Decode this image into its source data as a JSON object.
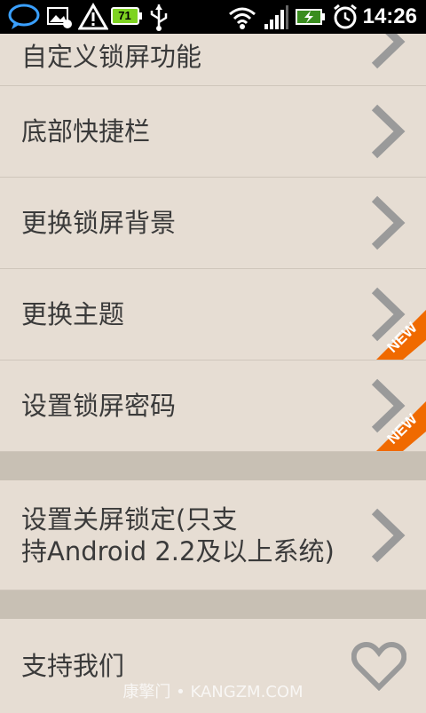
{
  "status_bar": {
    "battery_level": "71",
    "time": "14:26"
  },
  "settings_list": {
    "partial_top_label": "自定义锁屏功能",
    "items": [
      {
        "label": "底部快捷栏"
      },
      {
        "label": "更换锁屏背景"
      },
      {
        "label": "更换主题",
        "badge": "NEW"
      },
      {
        "label": "设置锁屏密码",
        "badge": "NEW"
      }
    ],
    "section2_item": {
      "label": "设置关屏锁定(只支\n持Android 2.2及以上系统)"
    },
    "section3_item": {
      "label": "支持我们"
    }
  },
  "watermark": "康擎门 • KANGZM.COM",
  "colors": {
    "background": "#e6ddd3",
    "separator": "#c8c0b4",
    "arrow": "#9a9a9a",
    "badge_orange": "#f06a00",
    "status_bar": "#000000"
  }
}
